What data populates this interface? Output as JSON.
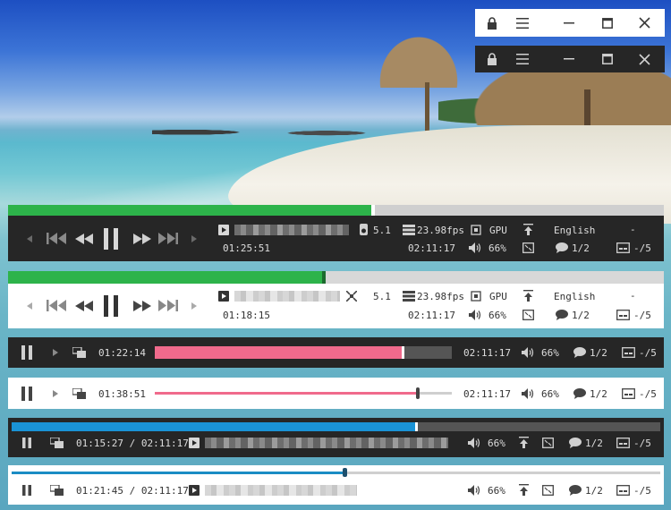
{
  "background": {
    "scene": "tropical-beach-wallpaper"
  },
  "title_bar_light": {
    "icons": [
      "lock-icon",
      "menu-icon",
      "minimize-icon",
      "maximize-icon",
      "close-icon"
    ]
  },
  "title_bar_dark": {
    "icons": [
      "lock-icon",
      "menu-icon",
      "minimize-icon",
      "maximize-icon",
      "close-icon"
    ]
  },
  "players": [
    {
      "theme": "dark",
      "elapsed": "01:25:51",
      "total": "02:11:17",
      "audio": "5.1",
      "fps": "23.98fps",
      "hw": "GPU",
      "language": "English",
      "extra": "-",
      "volume": "66%",
      "subtitles": "1/2",
      "sub_offset": "-/5",
      "progress": 0.556,
      "progress_color": "#2db34a"
    },
    {
      "theme": "light",
      "elapsed": "01:18:15",
      "total": "02:11:17",
      "audio": "5.1",
      "fps": "23.98fps",
      "hw": "GPU",
      "language": "English",
      "extra": "-",
      "volume": "66%",
      "subtitles": "1/2",
      "sub_offset": "-/5",
      "progress": 0.481,
      "progress_color": "#2db34a"
    },
    {
      "theme": "dark",
      "elapsed": "01:22:14",
      "total": "02:11:17",
      "volume": "66%",
      "subtitles": "1/2",
      "sub_offset": "-/5",
      "progress": 0.836,
      "progress_color": "#f06a8c"
    },
    {
      "theme": "light",
      "elapsed": "01:38:51",
      "total": "02:11:17",
      "volume": "66%",
      "subtitles": "1/2",
      "sub_offset": "-/5",
      "progress": 0.886,
      "progress_color": "#f06a8c"
    },
    {
      "theme": "dark",
      "time_combined": "01:15:27 / 02:11:17",
      "volume": "66%",
      "subtitles": "1/2",
      "sub_offset": "-/5",
      "progress": 0.625,
      "progress_color": "#1a93d6"
    },
    {
      "theme": "light",
      "time_combined": "01:21:45 / 02:11:17",
      "volume": "66%",
      "subtitles": "1/2",
      "sub_offset": "-/5",
      "progress": 0.513,
      "progress_color": "#1a8cc4"
    }
  ]
}
